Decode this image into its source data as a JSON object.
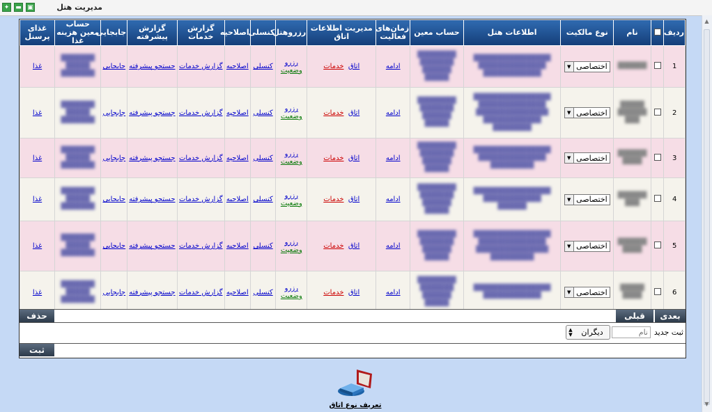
{
  "window": {
    "title": "مدیریت هتل"
  },
  "headers": [
    "ردیف",
    "",
    "نام",
    "نوع مالکیت",
    "اطلاعات هتل",
    "حساب معین",
    "زمان‌های فعالیت",
    "مدیریت اطلاعات اتاق",
    "رزروهتل",
    "کنسلی",
    "اصلاحیه",
    "گزارش خدمات",
    "گزارش پیشرفته",
    "جابجایی",
    "حساب معین هزینه غذا",
    "غذای پرسنل"
  ],
  "rows": [
    {
      "index": "1",
      "ownership": "اختصاصی"
    },
    {
      "index": "2",
      "ownership": "اختصاصی"
    },
    {
      "index": "3",
      "ownership": "اختصاصی"
    },
    {
      "index": "4",
      "ownership": "اختصاصی"
    },
    {
      "index": "5",
      "ownership": "اختصاصی"
    },
    {
      "index": "6",
      "ownership": "اختصاصی"
    }
  ],
  "links": {
    "continue": "ادامه",
    "room": "اتاق",
    "services": "خدمات",
    "reserve": "رزرو",
    "status": "وضعیت",
    "cancel": "کنسلی",
    "amend": "اصلاحیه",
    "service_report": "گزارش خدمات",
    "advanced_search": "جستجو پیشرفته",
    "transfer": "جابجایی",
    "food": "غذا"
  },
  "pager": {
    "next": "بعدی",
    "prev": "قبلی",
    "delete": "حذف"
  },
  "new_entry": {
    "label": "ثبت جدید",
    "name_placeholder": "نام",
    "type_value": "دیگران",
    "submit": "ثبت"
  },
  "footer": {
    "define_room_type": "تعریف نوع اتاق"
  }
}
